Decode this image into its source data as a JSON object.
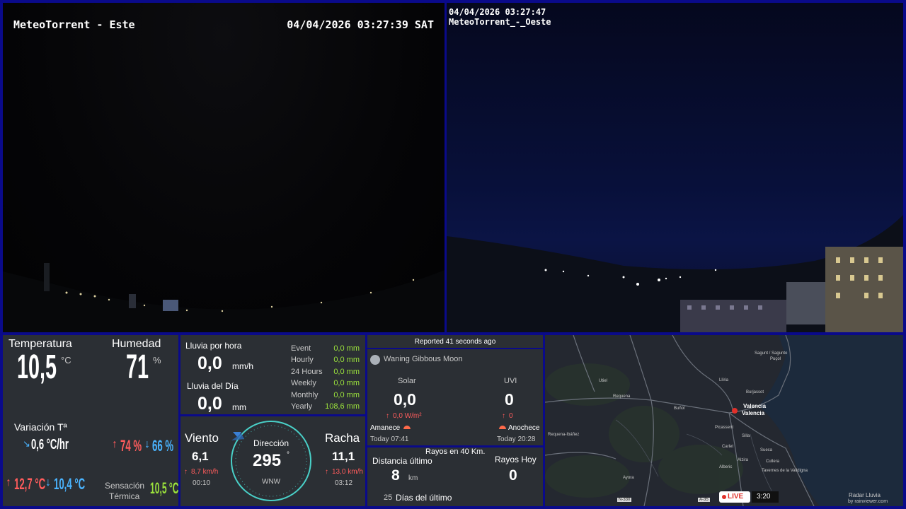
{
  "camera_east": {
    "title": "MeteoTorrent - Este",
    "timestamp": "04/04/2026 03:27:39 SAT"
  },
  "camera_west": {
    "timestamp": "04/04/2026 03:27:47",
    "title": "MeteoTorrent_-_Oeste"
  },
  "temperature": {
    "label": "Temperatura",
    "value": "10,5",
    "unit": "°C",
    "humidity_label": "Humedad",
    "humidity_value": "71",
    "humidity_unit": "%",
    "variation_label": "Variación Tª",
    "variation_value": "0,6 °C/hr",
    "hum_max": "74 %",
    "hum_min": "66 %",
    "temp_max": "12,7 °C",
    "temp_min": "10,4 °C",
    "feels_label_1": "Sensación",
    "feels_label_2": "Térmica",
    "feels_value": "10,5 °C"
  },
  "rain": {
    "hour_label": "Lluvia por hora",
    "hour_value": "0,0",
    "hour_unit": "mm/h",
    "day_label": "Lluvia del Día",
    "day_value": "0,0",
    "day_unit": "mm",
    "rows": [
      {
        "label": "Event",
        "value": "0,0 mm"
      },
      {
        "label": "Hourly",
        "value": "0,0 mm"
      },
      {
        "label": "24 Hours",
        "value": "0,0 mm"
      },
      {
        "label": "Weekly",
        "value": "0,0 mm"
      },
      {
        "label": "Monthly",
        "value": "0,0 mm"
      },
      {
        "label": "Yearly",
        "value": "108,6 mm"
      }
    ]
  },
  "wind": {
    "wind_label": "Viento",
    "wind_value": "6,1",
    "wind_max": "8,7 km/h",
    "wind_time": "00:10",
    "direction_label": "Dirección",
    "direction_value": "295",
    "direction_unit": "°",
    "direction_compass": "WNW",
    "gust_label": "Racha",
    "gust_value": "11,1",
    "gust_max": "13,0 km/h",
    "gust_time": "03:12"
  },
  "solar": {
    "reported": "Reported 41 seconds ago",
    "moon": "Waning Gibbous Moon",
    "solar_label": "Solar",
    "solar_value": "0,0",
    "solar_max": "0,0 W/m²",
    "uvi_label": "UVI",
    "uvi_value": "0",
    "uvi_max": "0",
    "sunrise_label": "Amanece",
    "sunrise_time": "Today 07:41",
    "sunset_label": "Anochece",
    "sunset_time": "Today 20:28"
  },
  "lightning": {
    "title": "Rayos en 40 Km.",
    "distance_label": "Distancia último",
    "distance_value": "8",
    "distance_unit": "km",
    "today_label": "Rayos Hoy",
    "today_value": "0",
    "days_value": "25",
    "days_label": "Días del último"
  },
  "map": {
    "places": [
      "Sagunt / Sagunto",
      "Puçol",
      "Llíria",
      "Burjassot",
      "Valencia",
      "Valencia",
      "Requena",
      "Buñol",
      "Utiel",
      "Picassent",
      "Silla",
      "Carlet",
      "Alzira",
      "Sueca",
      "Cullera",
      "Tavernes de la Valldigna",
      "Ayora",
      "Alberic",
      "Requena-Ibáñez"
    ],
    "roads": [
      "N-330",
      "A-35"
    ],
    "live": "LIVE",
    "time": "3:20",
    "credit_1": "Radar Lluvia",
    "credit_2": "by rainviewer.com"
  }
}
